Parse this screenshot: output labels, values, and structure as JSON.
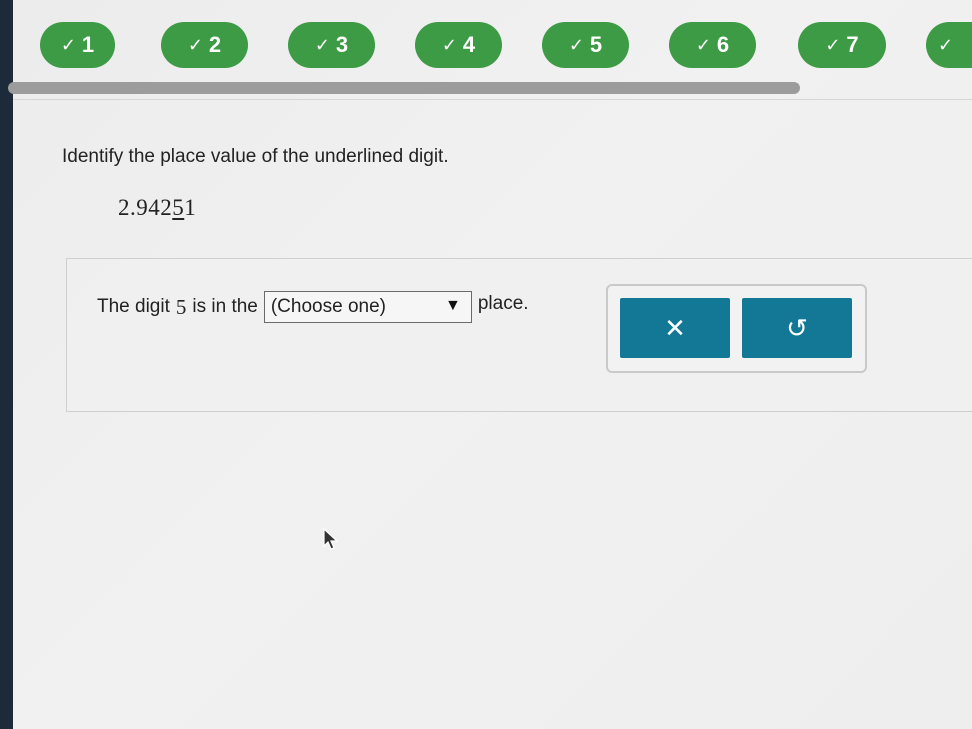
{
  "progress_nav": {
    "items": [
      {
        "label": "1",
        "status": "completed"
      },
      {
        "label": "2",
        "status": "completed"
      },
      {
        "label": "3",
        "status": "completed"
      },
      {
        "label": "4",
        "status": "completed"
      },
      {
        "label": "5",
        "status": "completed"
      },
      {
        "label": "6",
        "status": "completed"
      },
      {
        "label": "7",
        "status": "completed"
      },
      {
        "label": "",
        "status": "completed"
      }
    ],
    "check_icon": "✓",
    "completed_color": "#3d9a45"
  },
  "question": {
    "prompt": "Identify the place value of the underlined digit.",
    "number_before": "2.942",
    "underlined_digit": "5",
    "number_after": "1"
  },
  "answer": {
    "text_before": "The digit",
    "digit": "5",
    "text_middle": "is in the",
    "select_value": "(Choose one)",
    "select_arrow": "▼",
    "text_after": "place."
  },
  "actions": {
    "clear_icon": "✕",
    "undo_icon": "↺",
    "button_color": "#127896"
  }
}
